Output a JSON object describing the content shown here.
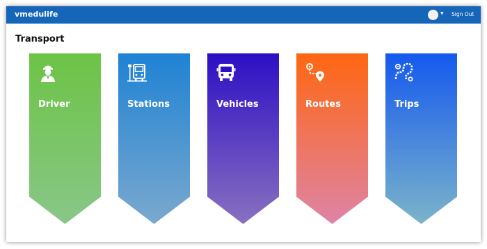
{
  "app": {
    "brand": "vmedulife"
  },
  "header": {
    "signout_label": "Sign Out"
  },
  "page": {
    "title": "Transport"
  },
  "cards": [
    {
      "label": "Driver",
      "icon": "driver-icon"
    },
    {
      "label": "Stations",
      "icon": "bus-stop-icon"
    },
    {
      "label": "Vehicles",
      "icon": "bus-icon"
    },
    {
      "label": "Routes",
      "icon": "route-icon"
    },
    {
      "label": "Trips",
      "icon": "trip-path-icon"
    }
  ],
  "colors": {
    "topbar": "#1565b8",
    "driver": [
      "#6cc445",
      "#89c689"
    ],
    "stations": [
      "#1f82d4",
      "#7aa9ce"
    ],
    "vehicles": [
      "#2d0fc4",
      "#8870c0"
    ],
    "routes": [
      "#ff6611",
      "#de84a6"
    ],
    "trips": [
      "#1559ee",
      "#7bb4ca"
    ]
  }
}
